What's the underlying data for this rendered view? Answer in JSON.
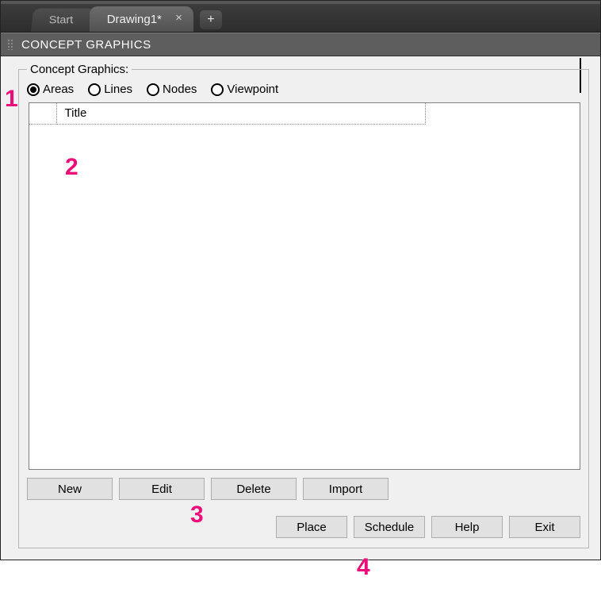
{
  "tabs": {
    "start": "Start",
    "drawing": "Drawing1*",
    "close_glyph": "×",
    "plus_glyph": "+"
  },
  "panel_title": "CONCEPT GRAPHICS",
  "group_legend": "Concept Graphics:",
  "radios": {
    "areas": "Areas",
    "lines": "Lines",
    "nodes": "Nodes",
    "viewpoint": "Viewpoint"
  },
  "list": {
    "col_blank": "",
    "col_title": "Title",
    "rows": []
  },
  "buttons_top": {
    "new": "New",
    "edit": "Edit",
    "delete": "Delete",
    "import": "Import"
  },
  "buttons_bottom": {
    "place": "Place",
    "schedule": "Schedule",
    "help": "Help",
    "exit": "Exit"
  },
  "annotations": {
    "a1": "1",
    "a2": "2",
    "a3": "3",
    "a4": "4"
  }
}
